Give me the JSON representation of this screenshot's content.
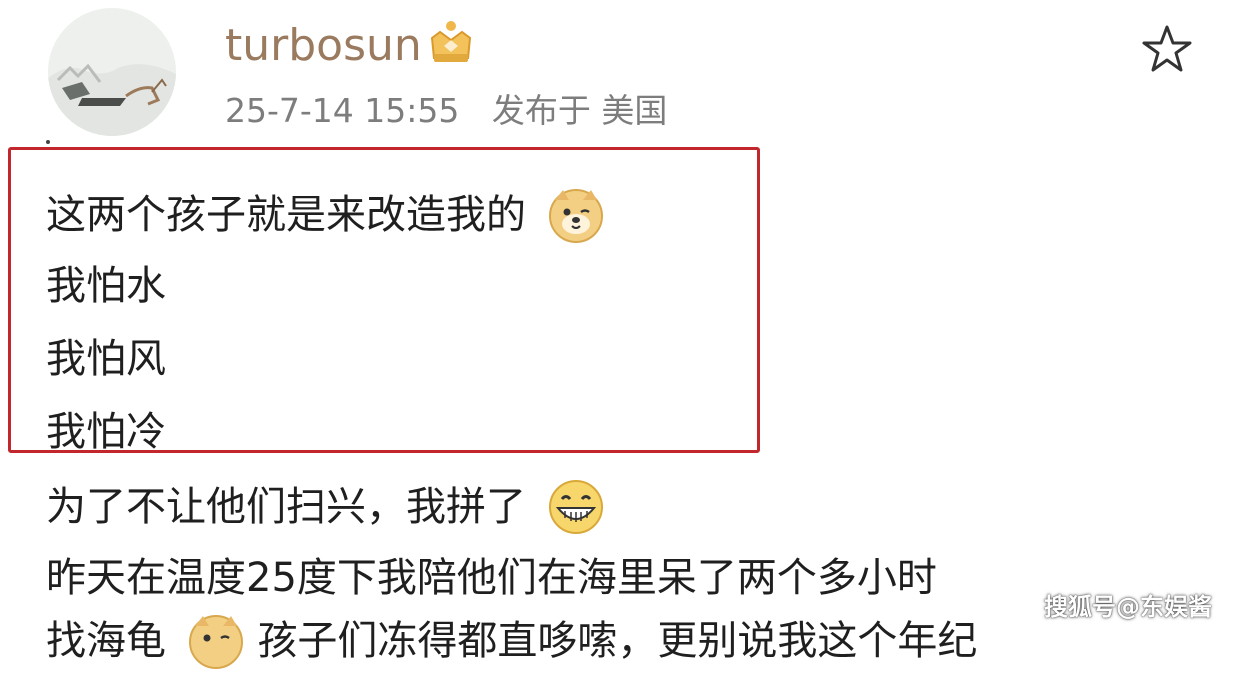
{
  "post": {
    "username": "turbosun",
    "timestamp": "25-7-14 15:55",
    "location_text": "发布于 美国",
    "lines": [
      "这两个孩子就是来改造我的",
      "我怕水",
      "我怕风",
      "我怕冷",
      "为了不让他们扫兴，我拼了",
      "昨天在温度25度下我陪他们在海里呆了两个多小时",
      "找海龟"
    ],
    "line7_tail": "孩子们冻得都直哆嗦，更别说我这个年纪"
  },
  "icons": {
    "avatar": "avatar-image",
    "badge": "crown-badge-icon",
    "favorite": "star-outline-icon",
    "emoji_1": "doge-emoji-icon",
    "emoji_2": "grin-emoji-icon",
    "emoji_3": "doge-emoji-icon"
  },
  "watermark": "搜狐号@东娱酱",
  "colors": {
    "username": "#9b7b5f",
    "highlight_border": "#c1272d",
    "meta_text": "#7d7d7d"
  }
}
